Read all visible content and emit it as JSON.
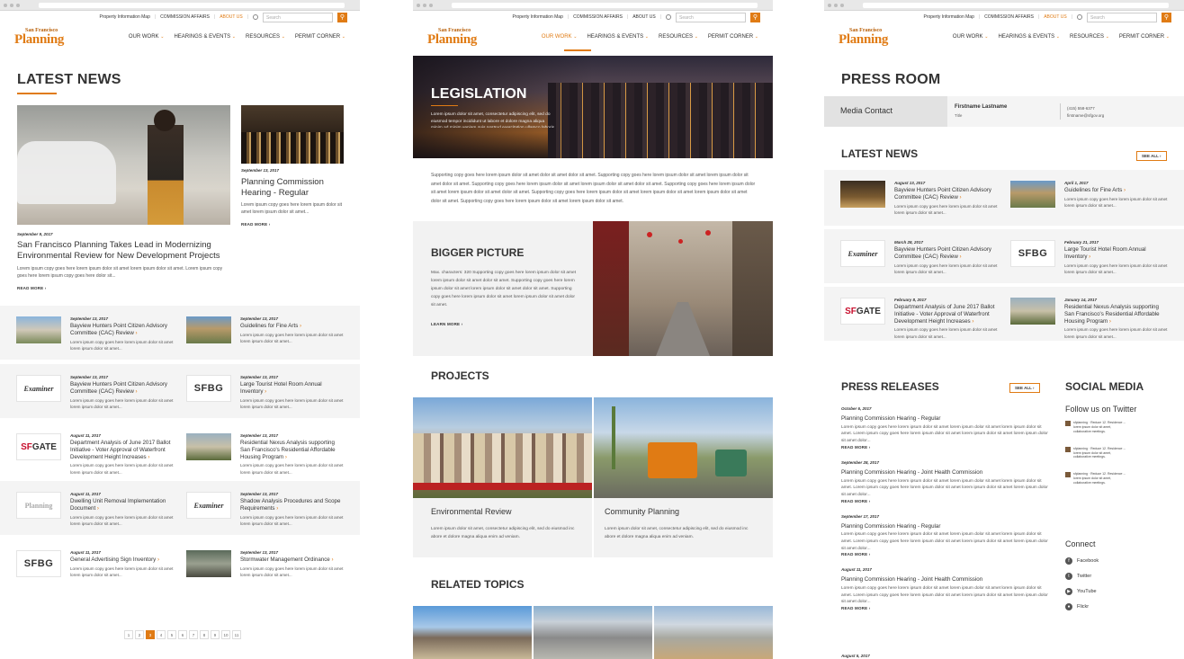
{
  "util": {
    "map": "Property Information Map",
    "commission": "COMMISSION AFFAIRS",
    "about": "ABOUT US",
    "search_placeholder": "Search"
  },
  "logo": {
    "small": "San Francisco",
    "big": "Planning"
  },
  "nav": [
    "OUR WORK",
    "HEARINGS & EVENTS",
    "RESOURCES",
    "PERMIT CORNER"
  ],
  "colors": {
    "accent": "#e07b14"
  },
  "p1": {
    "title": "LATEST NEWS",
    "feature": {
      "date": "September 9, 2017",
      "title": "San Francisco Planning Takes Lead in Modernizing Environmental Review for New Development Projects",
      "body": "Lorem ipsum copy goes here lorem ipsum dolor sit amet lorem ipsum dolor sit amet. Lorem ipsum copy goes here lorem ipsum copy goes here  dolor sit...",
      "more": "READ MORE"
    },
    "side": {
      "date": "September 13, 2017",
      "title": "Planning Commission Hearing - Regular",
      "body": "Lorem ipsum copy goes here lorem ipsum dolor sit amet lorem ipsum dolor sit amet...",
      "more": "READ MORE"
    },
    "rows": [
      [
        {
          "date": "September 13, 2017",
          "title": "Bayview Hunters Point Citizen Advisory Committee (CAC) Review",
          "thumb": "city"
        },
        {
          "date": "September 13, 2017",
          "title": "Guidelines for Fine Arts",
          "thumb": "palace"
        }
      ],
      [
        {
          "date": "September 13, 2017",
          "title": "Bayview Hunters Point Citizen Advisory Committee (CAC) Review",
          "thumb": "Examiner"
        },
        {
          "date": "September 13, 2017",
          "title": "Large Tourist Hotel Room Annual Inventory",
          "thumb": "SFBG"
        }
      ],
      [
        {
          "date": "August 11, 2017",
          "title": "Department Analysis of June 2017 Ballot Initiative - Voter Approval of Waterfront Development Height Increases",
          "thumb": "SFGATE"
        },
        {
          "date": "September 13, 2017",
          "title": "Residential Nexus Analysis supporting San Francisco's Residential Affordable Housing Program",
          "thumb": "street"
        }
      ],
      [
        {
          "date": "August 11, 2017",
          "title": "Dwelling Unit Removal Implementation Document",
          "thumb": "SFPlanning"
        },
        {
          "date": "September 13, 2017",
          "title": "Shadow Analysis Procedures and Scope Requirements",
          "thumb": "Examiner"
        }
      ],
      [
        {
          "date": "August 11, 2017",
          "title": "General Advertising Sign Inventory",
          "thumb": "SFBG"
        },
        {
          "date": "September 13, 2017",
          "title": "Stormwater Management Ordinance",
          "thumb": "rain"
        }
      ]
    ],
    "row_body": "Lorem ipsum copy goes here lorem ipsum dolor sit amet lorem ipsum dolor sit amet...",
    "pages": [
      "1",
      "2",
      "3",
      "4",
      "5",
      "6",
      "7",
      "8",
      "9",
      "10",
      "11"
    ]
  },
  "p2": {
    "hero_title": "LEGISLATION",
    "hero_body": "Lorem ipsum dolor sit amet, consectetur adipiscing elit, sed do eiusmod tempor incididunt ut labore et dolore magna aliqua minim ad minim veniam quis nostrud exercitation ullamco laboris nisi ut aliquip ex ea commodo consequat.",
    "supporting": "Supporting copy goes here lorem ipsum dolor sit amet dolor sit amet dolor sit amet. Supporting copy goes here lorem ipsum dolor sit amet lorem ipsum dolor sit amet dolor sit amet. Supporting copy goes here lorem ipsum dolor sit amet lorem ipsum dolor sit amet dolor sit amet. Supporting copy goes here lorem ipsum dolor sit amet lorem ipsum dolor sit amet dolor sit amet. Supporting copy goes here lorem ipsum dolor sit amet lorem ipsum dolor sit amet lorem ipsum dolor sit amet dolor sit amet. Supporting copy goes here lorem ipsum dolor sit amet lorem ipsum dolor sit amet.",
    "bigger_title": "BIGGER PICTURE",
    "bigger_body": "Max. characters: 320 Supporting copy goes here lorem ipsum dolor sit amet lorem ipsum dolor sit amet dolor sit amet. Supporting copy goes here lorem ipsum dolor sit amet lorem ipsum dolor sit amet dolor sit amet. Supporting copy goes here lorem ipsum dolor sit amet lorem ipsum dolor sit amet dolor sit amet.",
    "learn_more": "LEARN MORE",
    "projects_title": "PROJECTS",
    "projects": [
      {
        "title": "Environmental Review",
        "body": "Lorem ipsum dolor sit amet, consectetur adipiscing elit, sed do eiusmod inc abore et dolore magna aliqua enim ad  veniam."
      },
      {
        "title": "Community Planning",
        "body": "Lorem ipsum dolor sit amet, consectetur adipiscing elit, sed do eiusmod inc abore et dolore magna aliqua enim ad veniam."
      }
    ],
    "related_title": "RELATED TOPICS"
  },
  "p3": {
    "title": "PRESS ROOM",
    "media_contact": "Media Contact",
    "contact_name": "Firstname Lastname",
    "contact_title": "Title",
    "contact_phone": "(415) 558-6377",
    "contact_email": "firstname@sfgov.org",
    "news_title": "LATEST NEWS",
    "see_all": "SEE ALL",
    "news": [
      [
        {
          "date": "August 13, 2017",
          "title": "Bayview Hunters Point Citizen Advisory Committee (CAC) Review",
          "thumb": "crowd"
        },
        {
          "date": "April 1, 2017",
          "title": "Guidelines for Fine Arts",
          "thumb": "palace"
        }
      ],
      [
        {
          "date": "March 28, 2017",
          "title": "Bayview Hunters Point Citizen Advisory Committee (CAC) Review",
          "thumb": "Examiner"
        },
        {
          "date": "February 21, 2017",
          "title": "Large Tourist Hotel Room Annual Inventory",
          "thumb": "SFBG"
        }
      ],
      [
        {
          "date": "February 8, 2017",
          "title": "Department Analysis of June 2017 Ballot Initiative - Voter Approval of Waterfront Development Height Increases",
          "thumb": "SFGATE"
        },
        {
          "date": "January 14, 2017",
          "title": "Residential Nexus Analysis supporting San Francisco's Residential Affordable Housing Program",
          "thumb": "street"
        }
      ]
    ],
    "news_body": "Lorem ipsum copy goes here lorem ipsum dolor sit amet lorem ipsum dolor sit amet...",
    "press_title": "PRESS RELEASES",
    "press": [
      {
        "date": "October 6, 2017",
        "title": "Planning Commission Hearing - Regular"
      },
      {
        "date": "September 28, 2017",
        "title": "Planning Commission Hearing - Joint Health Commission"
      },
      {
        "date": "September 17, 2017",
        "title": "Planning Commission Hearing - Regular"
      },
      {
        "date": "August 11, 2017",
        "title": "Planning Commission Hearing - Joint Health Commission"
      }
    ],
    "press_body": "Lorem ipsum copy goes here lorem ipsum dolor sit amet lorem ipsum dolor sit amet lorem ipsum dolor sit amet. Lorem ipsum copy goes here lorem ipsum dolor sit amet lorem ipsum dolor sit amet lorem ipsum dolor sit amet dolor...",
    "read_more": "READ MORE",
    "last_date": "August 5, 2017",
    "social_title": "SOCIAL MEDIA",
    "follow": "Follow us on Twitter",
    "connect": "Connect",
    "social": [
      "Facebook",
      "Twitter",
      "YouTube",
      "Flickr"
    ]
  }
}
